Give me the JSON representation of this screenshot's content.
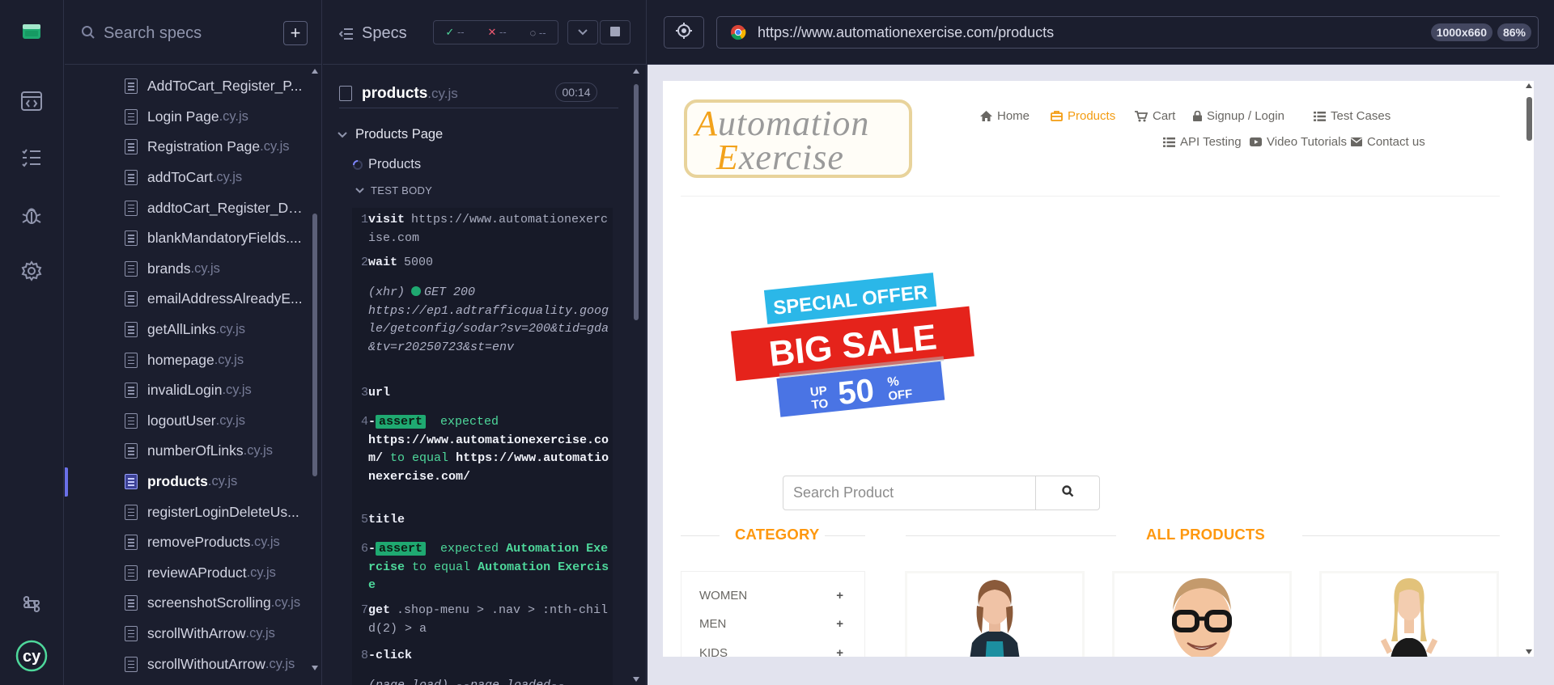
{
  "sidebar": {
    "icons": [
      "cypress-app-icon",
      "specs-icon",
      "runs-icon",
      "debug-icon",
      "settings-icon",
      "keyboard-shortcuts-icon",
      "cypress-logo-icon"
    ]
  },
  "specs_panel": {
    "search_placeholder": "Search specs",
    "add_label": "+",
    "files": [
      {
        "name": "AddToCart_Register_P...",
        "ext": ""
      },
      {
        "name": "Login Page",
        "ext": ".cy.js"
      },
      {
        "name": "Registration Page",
        "ext": ".cy.js"
      },
      {
        "name": "addToCart",
        "ext": ".cy.js"
      },
      {
        "name": "addtoCart_Register_De...",
        "ext": ""
      },
      {
        "name": "blankMandatoryFields....",
        "ext": ""
      },
      {
        "name": "brands",
        "ext": ".cy.js"
      },
      {
        "name": "emailAddressAlreadyE...",
        "ext": ""
      },
      {
        "name": "getAllLinks",
        "ext": ".cy.js"
      },
      {
        "name": "homepage",
        "ext": ".cy.js"
      },
      {
        "name": "invalidLogin",
        "ext": ".cy.js"
      },
      {
        "name": "logoutUser",
        "ext": ".cy.js"
      },
      {
        "name": "numberOfLinks",
        "ext": ".cy.js"
      },
      {
        "name": "products",
        "ext": ".cy.js",
        "active": true
      },
      {
        "name": "registerLoginDeleteUs...",
        "ext": ""
      },
      {
        "name": "removeProducts",
        "ext": ".cy.js"
      },
      {
        "name": "reviewAProduct",
        "ext": ".cy.js"
      },
      {
        "name": "screenshotScrolling",
        "ext": ".cy.js"
      },
      {
        "name": "scrollWithArrow",
        "ext": ".cy.js"
      },
      {
        "name": "scrollWithoutArrow",
        "ext": ".cy.js"
      }
    ]
  },
  "reporter": {
    "title": "Specs",
    "passed": "--",
    "failed": "--",
    "pending": "--",
    "file_name": "products",
    "file_ext": ".cy.js",
    "duration": "00:14",
    "suite": "Products Page",
    "test": "Products",
    "body_label": "TEST BODY",
    "commands": {
      "c1": {
        "num": "1",
        "name": "visit",
        "arg": "https://www.automationexercise.com"
      },
      "c2": {
        "num": "2",
        "name": "wait",
        "arg": "5000"
      },
      "xhr": {
        "label": "(xhr)",
        "status": "GET 200",
        "url": "https://ep1.adtrafficquality.google/getconfig/sodar?sv=200&tid=gda&tv=r20250723&st=env"
      },
      "c3": {
        "num": "3",
        "name": "url"
      },
      "c4": {
        "num": "4",
        "prefix": "-",
        "badge": "assert",
        "w1": "expected",
        "v1": "https://www.automationexercise.com/",
        "w2": "to equal",
        "v2": "https://www.automationexercise.com/"
      },
      "c5": {
        "num": "5",
        "name": "title"
      },
      "c6": {
        "num": "6",
        "prefix": "-",
        "badge": "assert",
        "w1": "expected",
        "v1": "Automation Exercise",
        "w2": "to equal",
        "v2": "Automation Exercise"
      },
      "c7": {
        "num": "7",
        "name": "get",
        "arg": ".shop-menu > .nav > :nth-child(2) > a"
      },
      "c8": {
        "num": "8",
        "name": "-click"
      },
      "pl": {
        "label": "(page load)",
        "text": "--page loaded--"
      }
    }
  },
  "aut": {
    "url": "https://www.automationexercise.com/products",
    "viewport": "1000x660",
    "zoom": "86%",
    "site": {
      "logo_line1_first": "A",
      "logo_line1_rest": "utomation",
      "logo_line2_first": "E",
      "logo_line2_rest": "xercise",
      "nav": {
        "home": "Home",
        "products": "Products",
        "cart": "Cart",
        "signup": "Signup / Login",
        "testcases": "Test Cases",
        "api": "API Testing",
        "videos": "Video Tutorials",
        "contact": "Contact us"
      },
      "banner": {
        "top": "SPECIAL OFFER",
        "middle": "BIG SALE",
        "up": "UP",
        "to": "TO",
        "percent": "50",
        "sign": "%",
        "off": "OFF"
      },
      "search_placeholder": "Search Product",
      "category_title": "CATEGORY",
      "products_title": "ALL PRODUCTS",
      "categories": [
        "WOMEN",
        "MEN",
        "KIDS"
      ],
      "plus": "+"
    }
  }
}
